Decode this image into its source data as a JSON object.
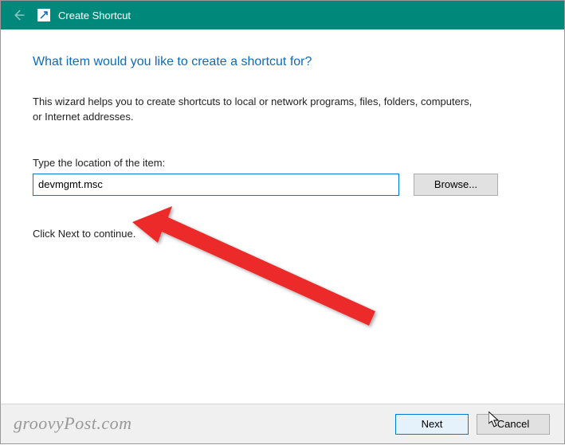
{
  "titlebar": {
    "title": "Create Shortcut"
  },
  "heading": "What item would you like to create a shortcut for?",
  "description": "This wizard helps you to create shortcuts to local or network programs, files, folders, computers, or Internet addresses.",
  "field": {
    "label": "Type the location of the item:",
    "value": "devmgmt.msc",
    "browse_label": "Browse..."
  },
  "continue_text": "Click Next to continue.",
  "footer": {
    "next_label": "Next",
    "cancel_label": "Cancel"
  },
  "watermark": "groovyPost.com"
}
